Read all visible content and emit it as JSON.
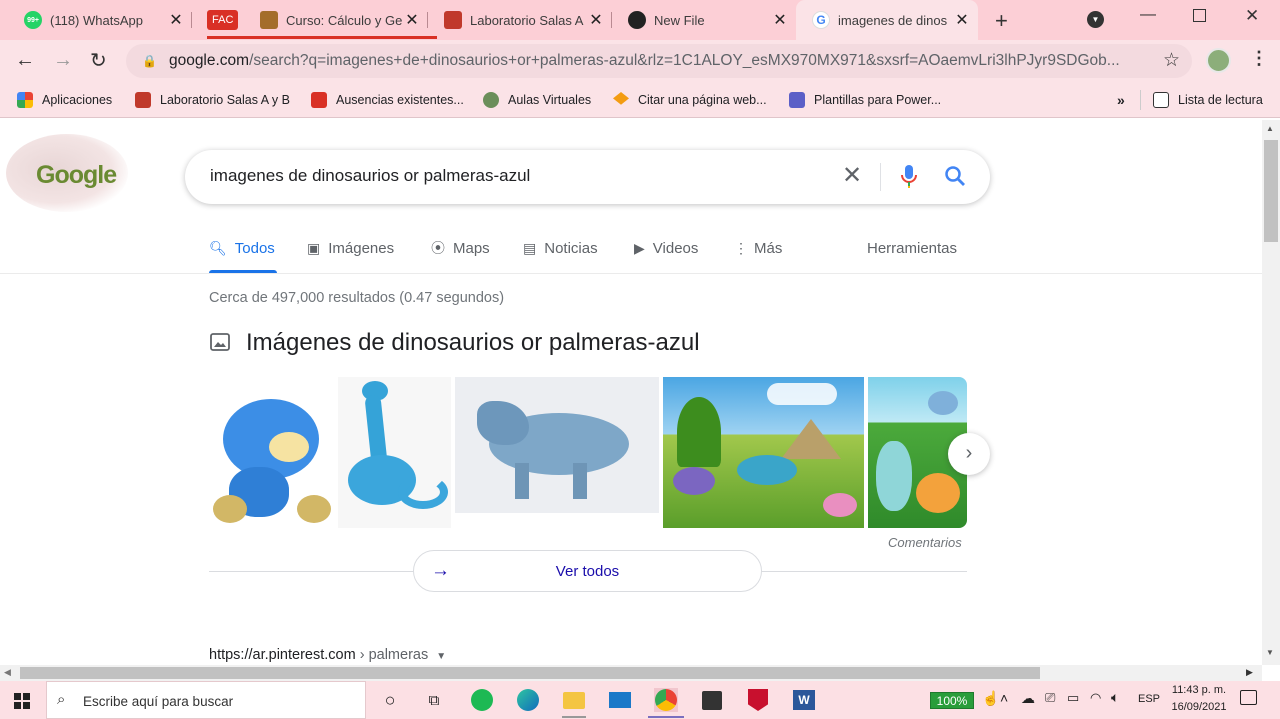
{
  "tabs": [
    {
      "title": "(118) WhatsApp",
      "badge": "99+"
    },
    {
      "title": "",
      "badge": "FAC"
    },
    {
      "title": "Curso: Cálculo y Ge"
    },
    {
      "title": "Laboratorio Salas A"
    },
    {
      "title": "New File"
    },
    {
      "title": "imagenes de dinos"
    }
  ],
  "address": {
    "host": "google.com",
    "path": "/search?q=imagenes+de+dinosaurios+or+palmeras-azul&rlz=1C1ALOY_esMX970MX971&sxsrf=AOaemvLri3lhPJyr9SDGob..."
  },
  "bookmarks": [
    {
      "label": "Aplicaciones"
    },
    {
      "label": "Laboratorio Salas A y B"
    },
    {
      "label": "Ausencias existentes..."
    },
    {
      "label": "Aulas Virtuales"
    },
    {
      "label": "Citar una página web..."
    },
    {
      "label": "Plantillas para Power..."
    }
  ],
  "reading_list": "Lista de lectura",
  "overflow": "»",
  "google": {
    "logo_text": "Google",
    "query": "imagenes de dinosaurios or palmeras-azul",
    "nav": [
      "Todos",
      "Imágenes",
      "Maps",
      "Noticias",
      "Videos",
      "Más"
    ],
    "tools": "Herramientas",
    "result_stats": "Cerca de 497,000 resultados (0.47 segundos)",
    "images_heading": "Imágenes de dinosaurios or palmeras-azul",
    "feedback": "Comentarios",
    "view_all": "Ver todos",
    "first_result": {
      "domain": "https://ar.pinterest.com",
      "crumb": "› palmeras"
    }
  },
  "taskbar": {
    "search_placeholder": "Escribe aquí para buscar",
    "battery": "100%",
    "lang": "ESP",
    "time": "11:43 p. m.",
    "date": "16/09/2021"
  },
  "colors": {
    "accent": "#1a73e8",
    "chrome": "#fccfd6",
    "toolbar": "#fbe3e7",
    "link": "#1a0dab"
  }
}
